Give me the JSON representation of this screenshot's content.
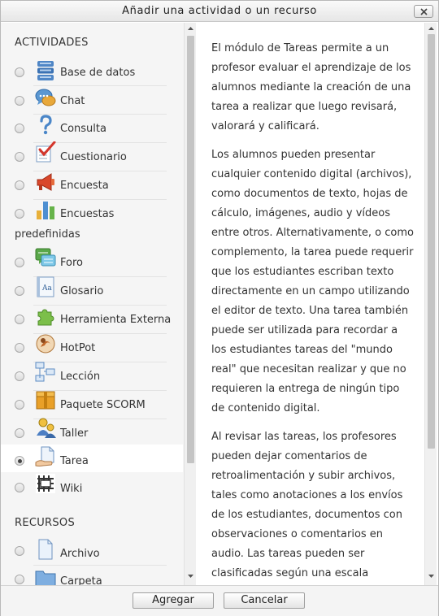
{
  "dialog": {
    "title": "Añadir una actividad o un recurso"
  },
  "left": {
    "activities_heading": "ACTIVIDADES",
    "resources_heading": "RECURSOS",
    "items": [
      {
        "label": "Base de datos",
        "icon": "database-icon",
        "selected": false
      },
      {
        "label": "Chat",
        "icon": "chat-bubbles-icon",
        "selected": false
      },
      {
        "label": "Consulta",
        "icon": "question-mark-icon",
        "selected": false
      },
      {
        "label": "Cuestionario",
        "icon": "checklist-icon",
        "selected": false
      },
      {
        "label": "Encuesta",
        "icon": "megaphone-icon",
        "selected": false
      },
      {
        "label": "Encuestas",
        "label_cont": "predefinidas",
        "icon": "bar-chart-icon",
        "selected": false
      },
      {
        "label": "Foro",
        "icon": "forum-icon",
        "selected": false
      },
      {
        "label": "Glosario",
        "icon": "glossary-book-icon",
        "selected": false
      },
      {
        "label": "Herramienta Externa",
        "icon": "puzzle-piece-icon",
        "selected": false
      },
      {
        "label": "HotPot",
        "icon": "hotpot-icon",
        "selected": false
      },
      {
        "label": "Lección",
        "icon": "lesson-flowchart-icon",
        "selected": false
      },
      {
        "label": "Paquete SCORM",
        "icon": "scorm-package-icon",
        "selected": false
      },
      {
        "label": "Taller",
        "icon": "workshop-people-icon",
        "selected": false
      },
      {
        "label": "Tarea",
        "icon": "assignment-hand-icon",
        "selected": true
      },
      {
        "label": "Wiki",
        "icon": "wiki-icon",
        "selected": false
      }
    ],
    "resources": [
      {
        "label": "Archivo",
        "icon": "file-icon"
      },
      {
        "label": "Carpeta",
        "icon": "folder-icon"
      }
    ]
  },
  "description": {
    "paragraphs": [
      "El módulo de Tareas permite a un profesor evaluar el aprendizaje de los alumnos mediante la creación de una tarea a realizar que luego revisará, valorará y calificará.",
      "Los alumnos pueden presentar cualquier contenido digital (archivos), como documentos de texto, hojas de cálculo, imágenes, audio y vídeos entre otros. Alternativamente, o como complemento, la tarea puede requerir que los estudiantes escriban texto directamente en un campo utilizando el editor de texto. Una tarea también puede ser utilizada para recordar a los estudiantes tareas del \"mundo real\" que necesitan realizar y que no requieren la entrega de ningún tipo de contenido digital.",
      "Al revisar las tareas, los profesores pueden dejar comentarios de retroalimentación y subir archivos, tales como anotaciones a los envíos de los estudiantes, documentos con observaciones o comentarios en audio. Las tareas pueden ser clasificadas según una escala"
    ]
  },
  "footer": {
    "add_label": "Agregar",
    "cancel_label": "Cancelar"
  }
}
